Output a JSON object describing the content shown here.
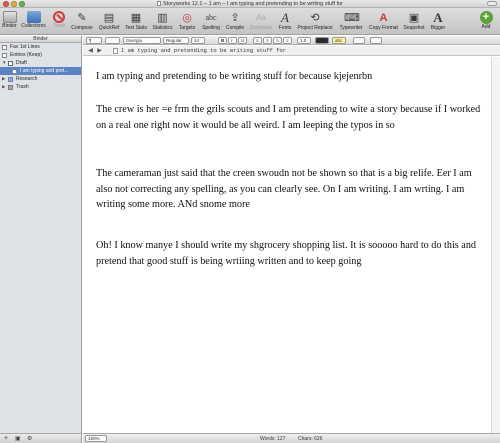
{
  "window": {
    "title": "Storyworks 12.1 – 1 am – I am typing and pretending to be writing stuff for"
  },
  "toolbar": {
    "items": [
      {
        "label": "Binder",
        "icon": "binder-icon"
      },
      {
        "label": "Collections",
        "icon": "collections-icon"
      },
      {
        "label": "Trash",
        "icon": "trash-icon"
      },
      {
        "label": "Compose",
        "icon": "compose-icon"
      },
      {
        "label": "QuickRef",
        "icon": "quickref-icon"
      },
      {
        "label": "Text Stats",
        "icon": "text-stats-icon"
      },
      {
        "label": "Statistics",
        "icon": "statistics-icon"
      },
      {
        "label": "Targets",
        "icon": "targets-icon"
      },
      {
        "label": "Spelling",
        "icon": "spelling-icon"
      },
      {
        "label": "Compile",
        "icon": "compile-icon"
      },
      {
        "label": "Dictionary",
        "icon": "dictionary-icon"
      },
      {
        "label": "Fonts",
        "icon": "fonts-icon"
      },
      {
        "label": "Project Replace",
        "icon": "project-replace-icon"
      },
      {
        "label": "Typewriter",
        "icon": "typewriter-icon"
      },
      {
        "label": "Copy Format",
        "icon": "copy-format-icon"
      },
      {
        "label": "Snapshot",
        "icon": "snapshot-icon"
      },
      {
        "label": "Bigger",
        "icon": "bigger-icon"
      },
      {
        "label": "Add",
        "icon": "add-icon"
      }
    ],
    "glyphs": {
      "compose": "✎",
      "quickref": "▤",
      "text_stats": "▦",
      "statistics": "▥",
      "targets": "◎",
      "spelling": "abc",
      "compile": "⇪",
      "dictionary": "Aa",
      "fonts": "A",
      "project_replace": "⟲",
      "typewriter": "⌨",
      "copy_format": "A",
      "snapshot": "▣",
      "bigger": "A",
      "add": "+"
    }
  },
  "formatbar": {
    "style_label": "¶",
    "font": "Georgia",
    "weight": "Regular",
    "size": "14",
    "bold": "B",
    "italic": "I",
    "underline": "U",
    "align": "≡",
    "spacing": "1.0",
    "highlight": "abc"
  },
  "header": {
    "doc_title": "I am typing and pretending to be writing stuff for",
    "back_arrow": "◀",
    "forward_arrow": "▶"
  },
  "binder": {
    "heading": "Binder",
    "items": [
      {
        "label": "Fav 1st Lines",
        "level": 0,
        "icon": "page",
        "expand": ""
      },
      {
        "label": "Entries (Keep)",
        "level": 0,
        "icon": "page",
        "expand": ""
      },
      {
        "label": "Draft",
        "level": 0,
        "icon": "draft",
        "expand": "▼"
      },
      {
        "label": "I am typing and pret...",
        "level": 1,
        "icon": "page",
        "expand": "",
        "selected": true
      },
      {
        "label": "Research",
        "level": 0,
        "icon": "folder",
        "expand": "▶"
      },
      {
        "label": "Trash",
        "level": 0,
        "icon": "trash",
        "expand": "▶"
      }
    ],
    "footer": {
      "add": "+",
      "folder": "▣",
      "settings": "⚙"
    }
  },
  "editor": {
    "paragraphs": [
      "I am typing and pretending to be writing stuff for because kjejenrbn",
      "The crew is her =e frm the grils scouts and I am pretending to wite  a story because if I worked on a real one right now it would be all weird. I am leeping the typos in so",
      "The cameraman just said that the creen swoudn not be shown so that is a big relife. Eer I am also not correcting any spelling, as you can clearly see. On I am writing. I am wrting. I am writing some more. ANd snome more",
      "Oh! I know manye I should write my shgrocery shopping list. It is sooooo hard to do this and pretend that good stuff is being wrtiing written and to keep going"
    ]
  },
  "footer": {
    "zoom": "150%",
    "words": "Words: 127",
    "chars": "Chars: 626"
  }
}
